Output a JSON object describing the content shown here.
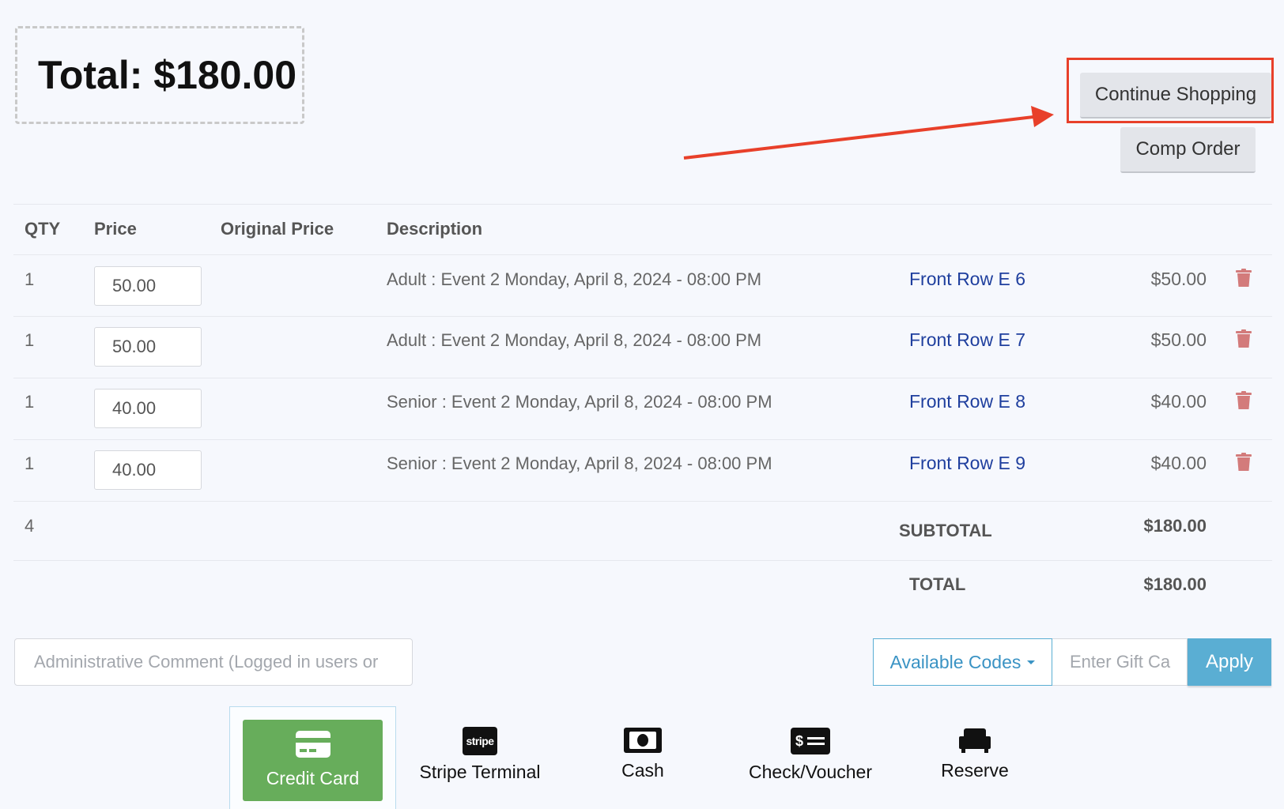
{
  "summary": {
    "total_label": "Total: $180.00"
  },
  "actions": {
    "continue_shopping": "Continue Shopping",
    "comp_order": "Comp Order"
  },
  "colors": {
    "annotation": "#e8402a",
    "link": "#1f3f9e",
    "accent": "#5aaed3",
    "success": "#67ad5b",
    "trash": "#d37b7b"
  },
  "table": {
    "headers": {
      "qty": "QTY",
      "price": "Price",
      "original_price": "Original Price",
      "description": "Description"
    },
    "rows": [
      {
        "qty": "1",
        "price": "50.00",
        "description": "Adult : Event 2 Monday, April 8, 2024 - 08:00 PM",
        "seat": "Front Row E 6",
        "amount": "$50.00"
      },
      {
        "qty": "1",
        "price": "50.00",
        "description": "Adult : Event 2 Monday, April 8, 2024 - 08:00 PM",
        "seat": "Front Row E 7",
        "amount": "$50.00"
      },
      {
        "qty": "1",
        "price": "40.00",
        "description": "Senior : Event 2 Monday, April 8, 2024 - 08:00 PM",
        "seat": "Front Row E 8",
        "amount": "$40.00"
      },
      {
        "qty": "1",
        "price": "40.00",
        "description": "Senior : Event 2 Monday, April 8, 2024 - 08:00 PM",
        "seat": "Front Row E 9",
        "amount": "$40.00"
      }
    ],
    "total_qty": "4",
    "subtotal_label": "SUBTOTAL",
    "subtotal_value": "$180.00",
    "total_label": "TOTAL",
    "total_value": "$180.00"
  },
  "comment": {
    "placeholder": "Administrative Comment (Logged in users or"
  },
  "codes": {
    "available_label": "Available Codes",
    "gift_placeholder": "Enter Gift Ca",
    "apply_label": "Apply"
  },
  "payment": {
    "credit_card": "Credit Card",
    "stripe_terminal": "Stripe Terminal",
    "stripe_logo": "stripe",
    "cash": "Cash",
    "check_voucher": "Check/Voucher",
    "reserve": "Reserve"
  }
}
